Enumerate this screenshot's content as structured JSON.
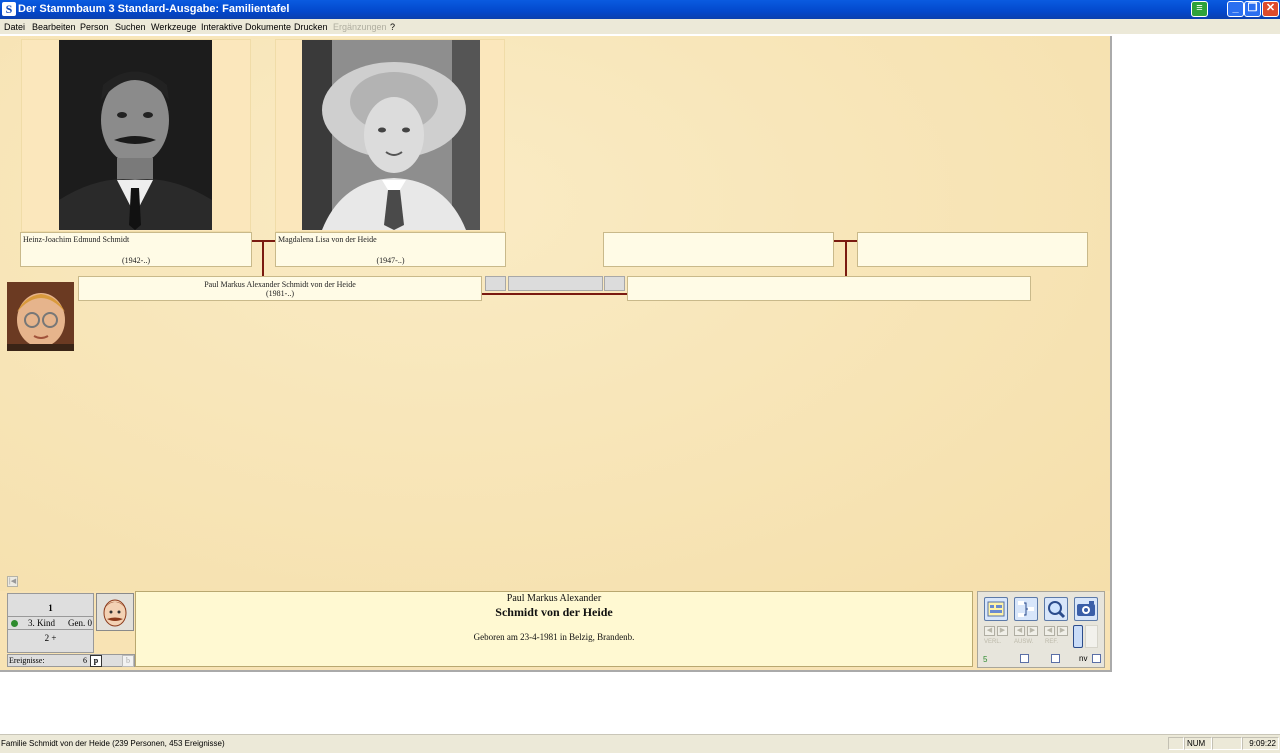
{
  "window": {
    "title": "Der Stammbaum 3 Standard-Ausgabe: Familientafel",
    "app_icon_letter": "S"
  },
  "menu": [
    "Datei",
    "Bearbeiten",
    "Person",
    "Suchen",
    "Werkzeuge",
    "Interaktive Dokumente",
    "Drucken",
    "Ergänzungen",
    "?"
  ],
  "menu_disabled": "Ergänzungen",
  "tree": {
    "father": {
      "name": "Heinz-Joachim Edmund Schmidt",
      "dates": "(1942-..)"
    },
    "mother": {
      "name": "Magdalena Lisa von der Heide",
      "dates": "(1947-..)"
    },
    "subject": {
      "name": "Paul Markus Alexander Schmidt von der Heide",
      "dates": "(1981-..)"
    }
  },
  "panel": {
    "child_number": "1",
    "child_label": "3. Kind",
    "generation": "Gen. 0",
    "siblings": "2 +",
    "events_label": "Ereignisse:",
    "events_count": "6",
    "events_p": "p",
    "events_b": "b",
    "first_names": "Paul Markus Alexander",
    "surname": "Schmidt von der Heide",
    "birth": "Geboren am 23-4-1981 in Belzig, Brandenb."
  },
  "tools": {
    "labels": [
      "VERL.",
      "AUSW.",
      "REF."
    ],
    "count": "5",
    "nv_label": "nv"
  },
  "status": {
    "text": "Familie Schmidt von der Heide (239 Personen, 453 Ereignisse)",
    "num": "NUM",
    "time": "9:09:22"
  },
  "colors": {
    "titlebar": "#0348cc",
    "canvas": "#f8e3b4",
    "connector": "#7a1a10",
    "infobox": "#fff9d2"
  }
}
